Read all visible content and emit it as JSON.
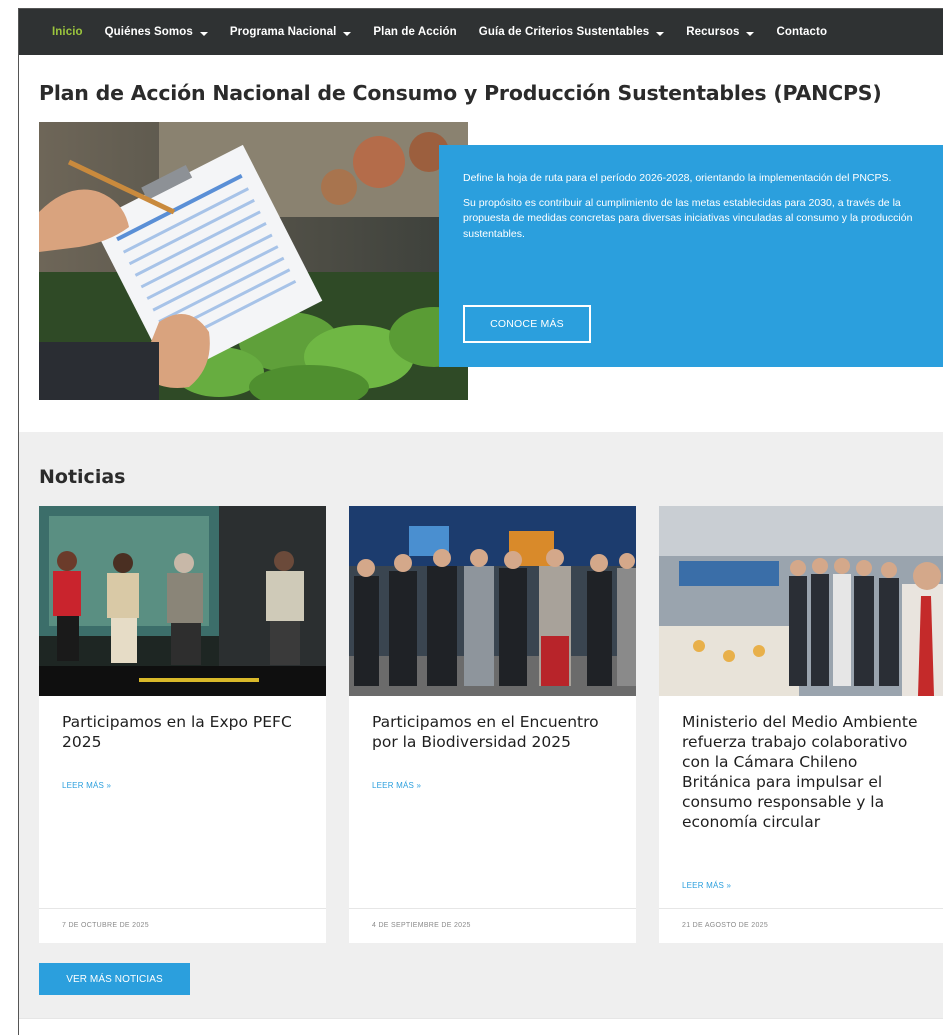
{
  "nav": {
    "items": [
      {
        "label": "Inicio",
        "caret": false,
        "active": true
      },
      {
        "label": "Quiénes Somos",
        "caret": true
      },
      {
        "label": "Programa Nacional",
        "caret": true
      },
      {
        "label": "Plan de Acción",
        "caret": false
      },
      {
        "label": "Guía de Criterios Sustentables",
        "caret": true
      },
      {
        "label": "Recursos",
        "caret": true
      },
      {
        "label": "Contacto",
        "caret": false
      }
    ],
    "active_color": "#9bc53d",
    "background": "#2f3233"
  },
  "hero": {
    "title": "Plan de Acción Nacional de Consumo y Producción Sustentables (PANCPS)",
    "paragraph_1": "Define la hoja de ruta para el período 2026-2028, orientando la implementación del PNCPS.",
    "paragraph_2": "Su propósito es contribuir al cumplimiento de las metas establecidas para 2030, a través de la propuesta de medidas concretas para diversas iniciativas vinculadas al consumo y la producción sustentables.",
    "button": "CONOCE MÁS",
    "box_color": "#2b9fdd"
  },
  "news": {
    "heading": "Noticias",
    "cards": [
      {
        "title": "Participamos en la Expo PEFC 2025",
        "more": "LEER MÁS »",
        "date": "7 DE OCTUBRE DE 2025"
      },
      {
        "title": "Participamos en el Encuentro por la Biodiversidad 2025",
        "more": "LEER MÁS »",
        "date": "4 DE SEPTIEMBRE DE 2025"
      },
      {
        "title": "Ministerio del Medio Ambiente refuerza trabajo colaborativo con la Cámara Chileno Británica para impulsar el consumo responsable y la economía circular",
        "more": "LEER MÁS »",
        "date": "21 DE AGOSTO DE 2025"
      }
    ],
    "more_button": "VER MÁS NOTICIAS"
  }
}
